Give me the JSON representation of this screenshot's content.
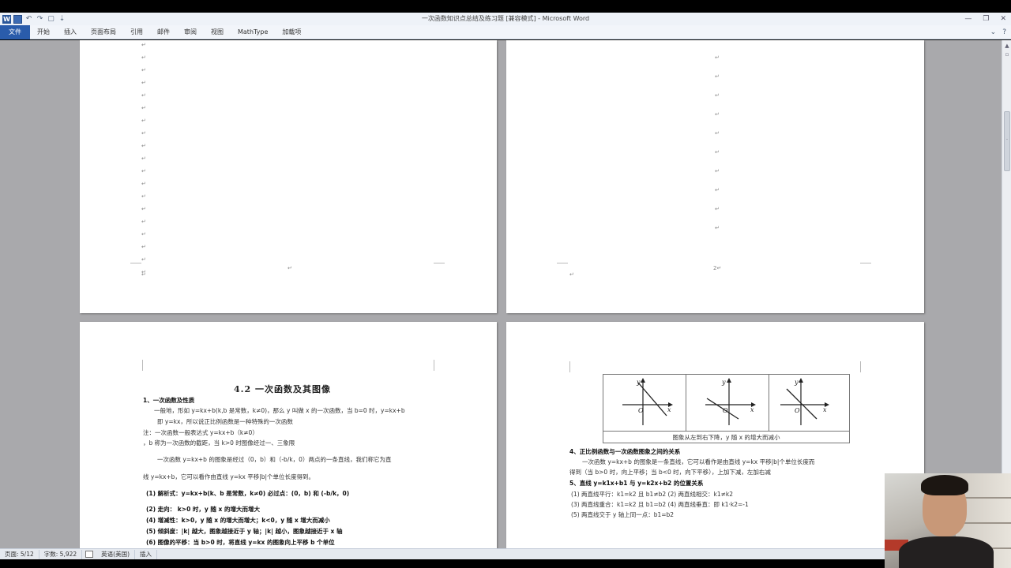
{
  "window": {
    "title": "一次函数知识点总结及练习题 [兼容模式] - Microsoft Word",
    "controls": [
      "—",
      "❐",
      "✕"
    ]
  },
  "quick_access": [
    "W",
    "",
    "↶",
    "↷",
    "▢",
    "⇣"
  ],
  "ribbon": {
    "tabs": [
      "文件",
      "开始",
      "插入",
      "页面布局",
      "引用",
      "邮件",
      "审阅",
      "视图",
      "MathType",
      "加载项"
    ],
    "right_icons": [
      "⌄",
      "?"
    ]
  },
  "pages": {
    "top_left": {
      "page_number": "↵"
    },
    "top_right": {
      "page_number": "2↵"
    }
  },
  "doc": {
    "section_title": "4.2  一次函数及其图像",
    "left_lines": [
      "1、一次函数及性质",
      "一般地，形如 y=kx+b(k,b 是常数，k≠0)，那么 y 叫做 x 的一次函数，当 b=0 时，y=kx+b",
      "即 y=kx，所以说正比例函数是一种特殊的一次函数",
      "注：一次函数一般表达式 y=kx+b（k≠0）",
      "，b 称为一次函数的截距，当 k>0 时图像经过一、三象限",
      "一次函数 y=kx+b 的图象是经过（0，b）和（-b/k，0）两点的一条直线，我们称它为直",
      "线 y=kx+b，它可以看作由直线 y=kx 平移|b|个单位长度得到。",
      "(1) 解析式：y=kx+b(k、b 是常数，k≠0)    必过点：(0，b) 和 (-b/k，0)",
      "(2) 走向：  k>0 时，y 随 x 的增大而增大",
      "(4) 增减性：k>0，y 随 x 的增大而增大；k<0，y 随 x 增大而减小",
      "(5) 倾斜度：|k| 越大，图象越接近于 y 轴；|k| 越小，图象越接近于 x 轴",
      "(6) 图像的平移：当 b>0 时，将直线 y=kx 的图象向上平移 b 个单位"
    ],
    "right_caption": "图象从左到右下降，y 随 x 的增大而减小",
    "right_lines": [
      "4、正比例函数与一次函数图象之间的关系",
      "一次函数 y=kx+b 的图象是一条直线，它可以看作是由直线 y=kx 平移|b|个单位长度而",
      "得到（当 b>0 时，向上平移；当 b<0 时，向下平移），上加下减，左加右减",
      "5、直线 y=k1x+b1 与 y=k2x+b2 的位置关系",
      "(1) 两直线平行：k1=k2 且 b1≠b2      (2) 两直线相交：k1≠k2",
      "(3) 两直线重合：k1=k2 且 b1=b2      (4) 两直线垂直：即 k1·k2=-1",
      "(5) 两直线交于 y 轴上同一点：b1=b2"
    ],
    "axis_labels": {
      "y": "y",
      "x": "x",
      "o": "O"
    }
  },
  "status": {
    "page": "页面: 5/12",
    "words": "字数: 5,922",
    "language": "英语(美国)",
    "mode": "插入"
  }
}
